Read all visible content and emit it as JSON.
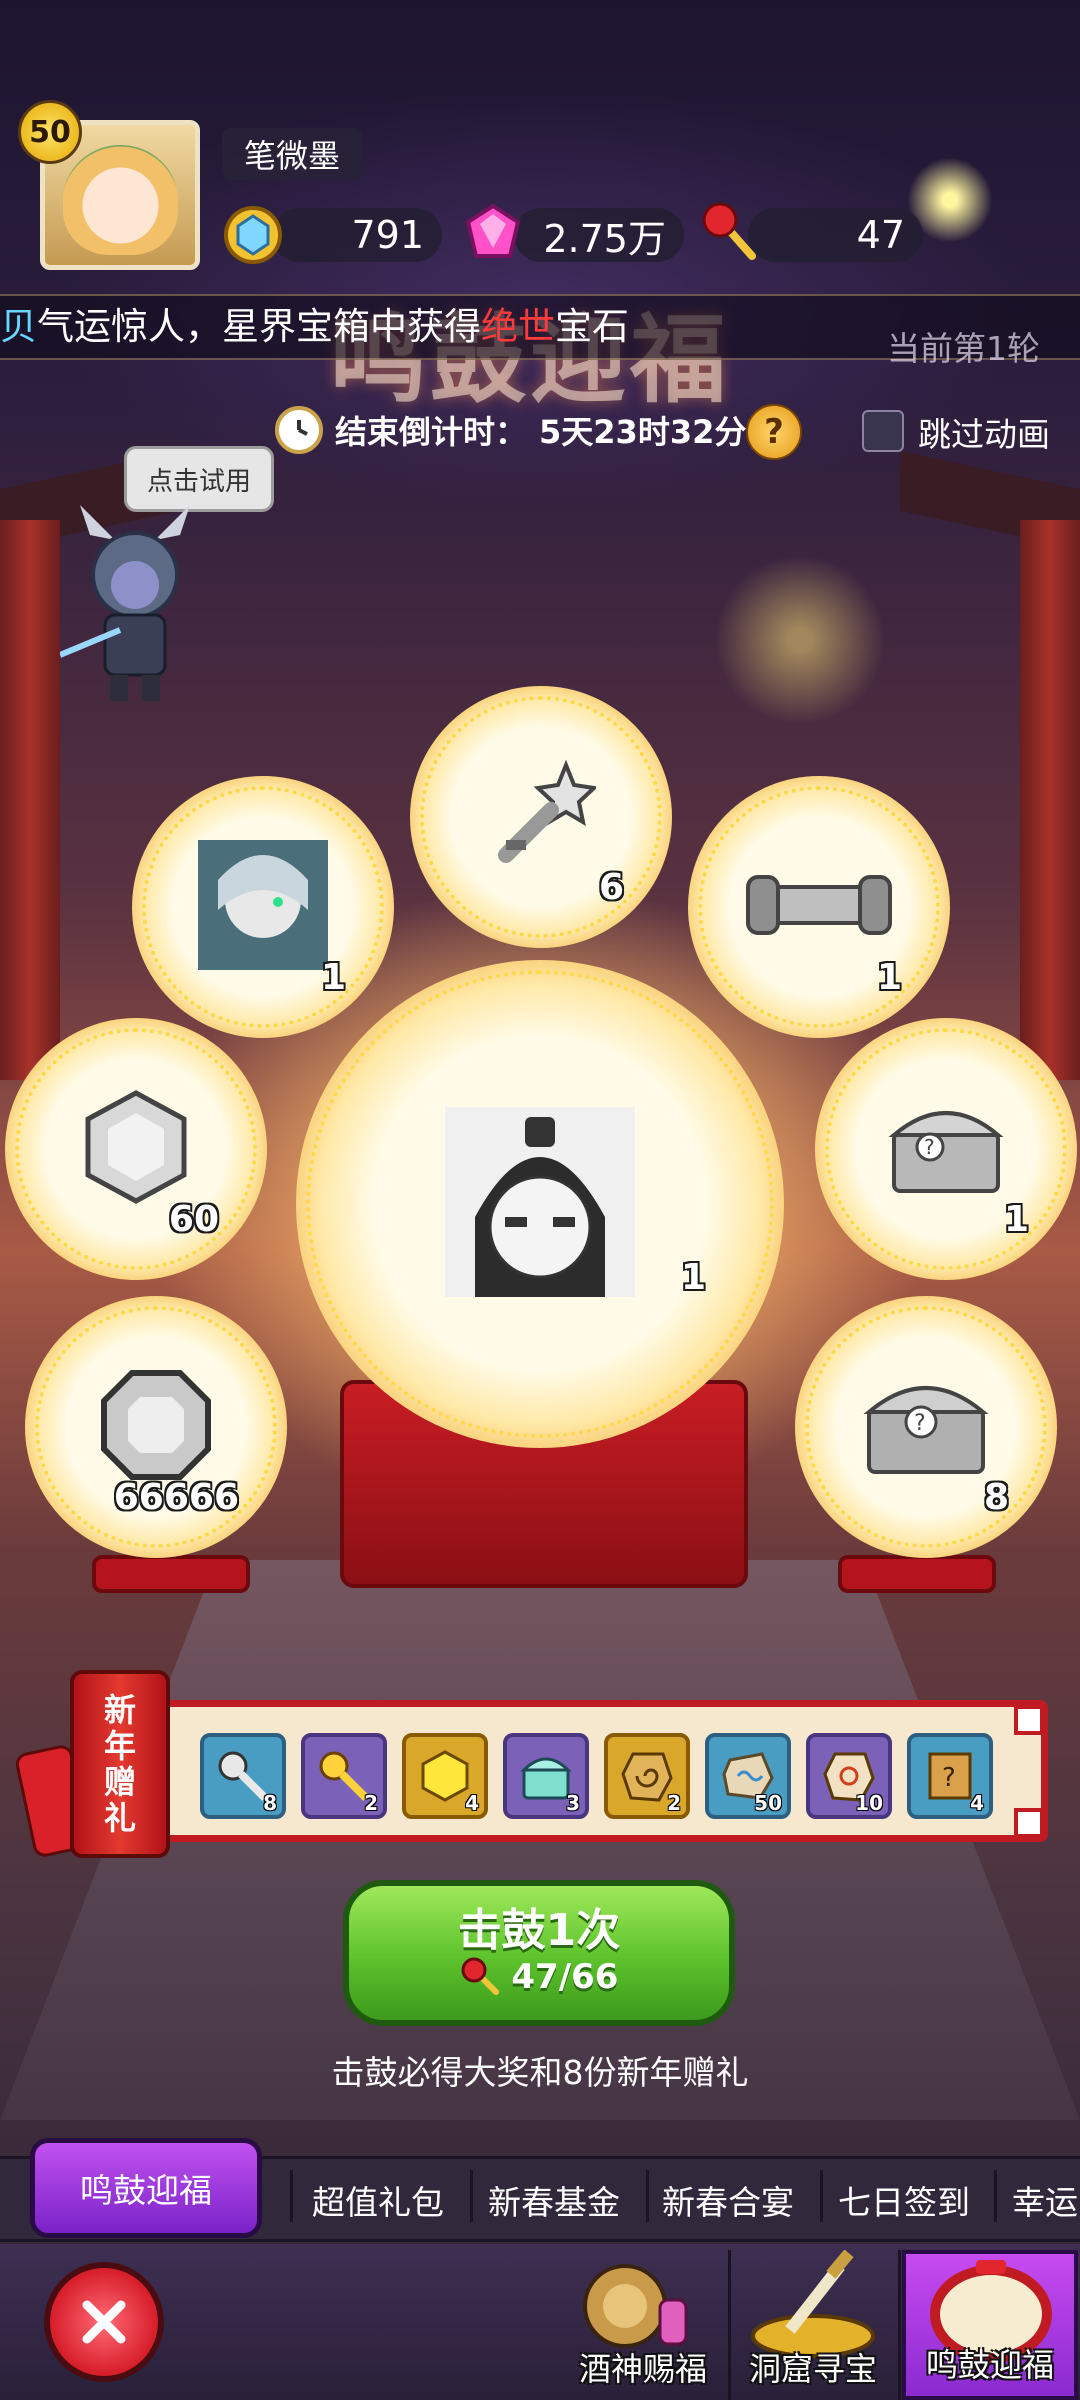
{
  "player": {
    "level": "50",
    "name": "笔微墨"
  },
  "resources": [
    {
      "icon": "gold-coin-icon",
      "value": "791"
    },
    {
      "icon": "pink-gem-icon",
      "value": "2.75万"
    },
    {
      "icon": "drumstick-icon",
      "value": "47"
    }
  ],
  "ticker": {
    "lead": "贝",
    "text_a": "气运惊人，星界宝箱中获得",
    "highlight": "绝世",
    "text_b": "宝石"
  },
  "event": {
    "title": "鸣鼓迎福",
    "round": "当前第1轮",
    "countdown_label": "结束倒计时：",
    "countdown": "5天23时32分",
    "help": "?",
    "skip_label": "跳过动画"
  },
  "hero": {
    "try_label": "点击试用"
  },
  "drums": [
    {
      "item": "hero-portrait-icon",
      "count": "1"
    },
    {
      "item": "star-key-icon",
      "count": "6"
    },
    {
      "item": "silver-bar-icon",
      "count": "1"
    },
    {
      "item": "silver-gem-icon",
      "count": "60"
    },
    {
      "item": "hero-portrait-icon",
      "count": "1"
    },
    {
      "item": "mystery-chest-icon",
      "count": "1"
    },
    {
      "item": "silver-ore-icon",
      "count": "66666"
    },
    {
      "item": "mystery-chest-icon",
      "count": "8"
    }
  ],
  "gifts": {
    "tag": [
      "新",
      "年",
      "赠",
      "礼"
    ],
    "items": [
      {
        "icon": "silver-key-icon",
        "count": "8"
      },
      {
        "icon": "gold-key-icon",
        "count": "2"
      },
      {
        "icon": "yellow-gem-icon",
        "count": "4"
      },
      {
        "icon": "teal-chest-icon",
        "count": "3"
      },
      {
        "icon": "spiral-stone-icon",
        "count": "2"
      },
      {
        "icon": "rune-stone-icon",
        "count": "50"
      },
      {
        "icon": "sun-stone-icon",
        "count": "10"
      },
      {
        "icon": "mystery-scroll-icon",
        "count": "4"
      }
    ]
  },
  "action": {
    "title": "击鼓1次",
    "cost": "47/66",
    "hint": "击鼓必得大奖和8份新年赠礼"
  },
  "tabs": {
    "active": "鸣鼓迎福",
    "items": [
      "超值礼包",
      "新春基金",
      "新春合宴",
      "七日签到",
      "幸运"
    ]
  },
  "bottom_nav": {
    "items": [
      "酒神赐福",
      "洞窟寻宝",
      "鸣鼓迎福"
    ]
  },
  "colors": {
    "accent_red": "#d9252b",
    "button_green": "#5cc22b",
    "active_purple": "#9a35d8"
  }
}
